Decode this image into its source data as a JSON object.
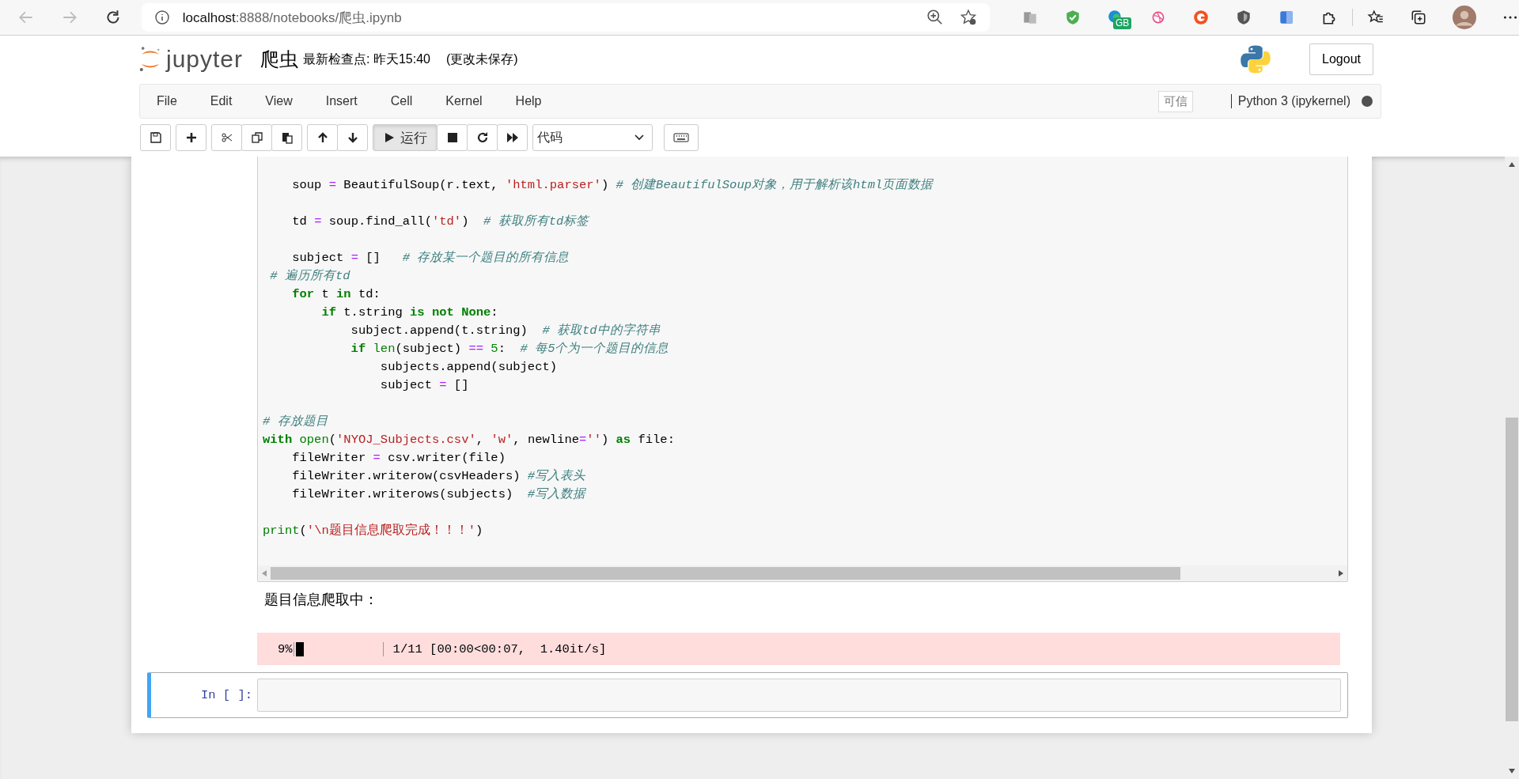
{
  "browser": {
    "url": {
      "host": "localhost",
      "path": ":8888/notebooks/爬虫.ipynb"
    },
    "extension_badge": "GB"
  },
  "header": {
    "logo_text": "jupyter",
    "notebook_name": "爬虫",
    "checkpoint": "最新检查点: 昨天15:40",
    "unsaved": "(更改未保存)",
    "logout": "Logout"
  },
  "menu": {
    "items": [
      "File",
      "Edit",
      "View",
      "Insert",
      "Cell",
      "Kernel",
      "Help"
    ],
    "trusted": "可信",
    "kernel_name": "Python 3 (ipykernel)",
    "kernel_busy": true
  },
  "toolbar": {
    "run_label": "运行",
    "cell_type": "代码"
  },
  "code_lines": [
    {
      "kind": "code",
      "tokens": [
        {
          "t": "    soup ",
          "kind": "plain"
        },
        {
          "t": "=",
          "kind": "op"
        },
        {
          "t": " BeautifulSoup(r.text, ",
          "kind": "plain"
        },
        {
          "t": "'html.parser'",
          "kind": "str"
        },
        {
          "t": ") ",
          "kind": "plain"
        },
        {
          "t": "# 创建BeautifulSoup对象，用于解析该html页面数据",
          "kind": "cm"
        }
      ]
    },
    {
      "kind": "blank"
    },
    {
      "kind": "code",
      "tokens": [
        {
          "t": "    td ",
          "kind": "plain"
        },
        {
          "t": "=",
          "kind": "op"
        },
        {
          "t": " soup.find_all(",
          "kind": "plain"
        },
        {
          "t": "'td'",
          "kind": "str"
        },
        {
          "t": ")  ",
          "kind": "plain"
        },
        {
          "t": "# 获取所有td标签",
          "kind": "cm"
        }
      ]
    },
    {
      "kind": "blank"
    },
    {
      "kind": "code",
      "tokens": [
        {
          "t": "    subject ",
          "kind": "plain"
        },
        {
          "t": "=",
          "kind": "op"
        },
        {
          "t": " []   ",
          "kind": "plain"
        },
        {
          "t": "# 存放某一个题目的所有信息",
          "kind": "cm"
        }
      ]
    },
    {
      "kind": "code",
      "tokens": [
        {
          "t": " # 遍历所有td",
          "kind": "cm"
        }
      ]
    },
    {
      "kind": "code",
      "tokens": [
        {
          "t": "    for",
          "kind": "kw"
        },
        {
          "t": " t ",
          "kind": "plain"
        },
        {
          "t": "in",
          "kind": "kw"
        },
        {
          "t": " td:",
          "kind": "plain"
        }
      ]
    },
    {
      "kind": "code",
      "tokens": [
        {
          "t": "        if",
          "kind": "kw"
        },
        {
          "t": " t.string ",
          "kind": "plain"
        },
        {
          "t": "is not None",
          "kind": "kw"
        },
        {
          "t": ":",
          "kind": "plain"
        }
      ]
    },
    {
      "kind": "code",
      "tokens": [
        {
          "t": "            subject.append(t.string)  ",
          "kind": "plain"
        },
        {
          "t": "# 获取td中的字符串",
          "kind": "cm"
        }
      ]
    },
    {
      "kind": "code",
      "tokens": [
        {
          "t": "            if ",
          "kind": "kw"
        },
        {
          "t": "len",
          "kind": "bi"
        },
        {
          "t": "(subject) ",
          "kind": "plain"
        },
        {
          "t": "==",
          "kind": "op"
        },
        {
          "t": " 5",
          "kind": "num"
        },
        {
          "t": ":  ",
          "kind": "plain"
        },
        {
          "t": "# 每5个为一个题目的信息",
          "kind": "cm"
        }
      ]
    },
    {
      "kind": "code",
      "tokens": [
        {
          "t": "                subjects.append(subject)",
          "kind": "plain"
        }
      ]
    },
    {
      "kind": "code",
      "tokens": [
        {
          "t": "                subject ",
          "kind": "plain"
        },
        {
          "t": "=",
          "kind": "op"
        },
        {
          "t": " []",
          "kind": "plain"
        }
      ]
    },
    {
      "kind": "blank"
    },
    {
      "kind": "code",
      "tokens": [
        {
          "t": "# 存放题目",
          "kind": "cm"
        }
      ]
    },
    {
      "kind": "code",
      "tokens": [
        {
          "t": "with",
          "kind": "kw"
        },
        {
          "t": " open",
          "kind": "bi"
        },
        {
          "t": "(",
          "kind": "plain"
        },
        {
          "t": "'NYOJ_Subjects.csv'",
          "kind": "str"
        },
        {
          "t": ", ",
          "kind": "plain"
        },
        {
          "t": "'w'",
          "kind": "str"
        },
        {
          "t": ", newline",
          "kind": "plain"
        },
        {
          "t": "=",
          "kind": "op"
        },
        {
          "t": "''",
          "kind": "str"
        },
        {
          "t": ") ",
          "kind": "plain"
        },
        {
          "t": "as",
          "kind": "kw"
        },
        {
          "t": " file:",
          "kind": "plain"
        }
      ]
    },
    {
      "kind": "code",
      "tokens": [
        {
          "t": "    fileWriter ",
          "kind": "plain"
        },
        {
          "t": "=",
          "kind": "op"
        },
        {
          "t": " csv.writer(file)",
          "kind": "plain"
        }
      ]
    },
    {
      "kind": "code",
      "tokens": [
        {
          "t": "    fileWriter.writerow(csvHeaders) ",
          "kind": "plain"
        },
        {
          "t": "#写入表头",
          "kind": "cm"
        }
      ]
    },
    {
      "kind": "code",
      "tokens": [
        {
          "t": "    fileWriter.writerows(subjects)  ",
          "kind": "plain"
        },
        {
          "t": "#写入数据",
          "kind": "cm"
        }
      ]
    },
    {
      "kind": "blank"
    },
    {
      "kind": "code",
      "tokens": [
        {
          "t": "print",
          "kind": "bi"
        },
        {
          "t": "(",
          "kind": "plain"
        },
        {
          "t": "'\\n题目信息爬取完成！！！'",
          "kind": "str"
        },
        {
          "t": ")",
          "kind": "plain"
        }
      ]
    }
  ],
  "output": {
    "text": "题目信息爬取中：",
    "progress": {
      "percent": "9%",
      "level": 0.09,
      "stats": "1/11 [00:00<00:07,  1.40it/s]"
    }
  },
  "new_cell": {
    "prompt": "In [ ]:"
  }
}
